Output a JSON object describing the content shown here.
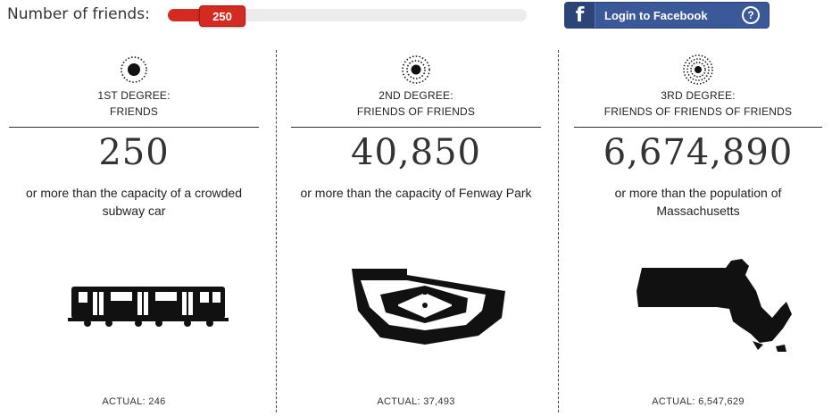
{
  "top": {
    "label": "Number of friends:",
    "slider_value": "250",
    "slider_level": 0.1,
    "facebook_logo": "f",
    "facebook_label": "Login to Facebook",
    "help_label": "?"
  },
  "columns": [
    {
      "title_line1": "1ST DEGREE:",
      "title_line2": "FRIENDS",
      "number": "250",
      "comparison": "or more than the capacity of a crowded subway car",
      "actual": "ACTUAL: 246",
      "icon": "subway-car-icon"
    },
    {
      "title_line1": "2ND DEGREE:",
      "title_line2": "FRIENDS OF FRIENDS",
      "number": "40,850",
      "comparison": "or more than the capacity of Fenway Park",
      "actual": "ACTUAL: 37,493",
      "icon": "ballpark-icon"
    },
    {
      "title_line1": "3RD DEGREE:",
      "title_line2": "FRIENDS OF FRIENDS OF FRIENDS",
      "number": "6,674,890",
      "comparison": "or more than the population of Massachusetts",
      "actual": "ACTUAL: 6,547,629",
      "icon": "massachusetts-map-icon"
    }
  ],
  "colors": {
    "accent_red": "#d42a22",
    "facebook_blue": "#3b5998"
  }
}
